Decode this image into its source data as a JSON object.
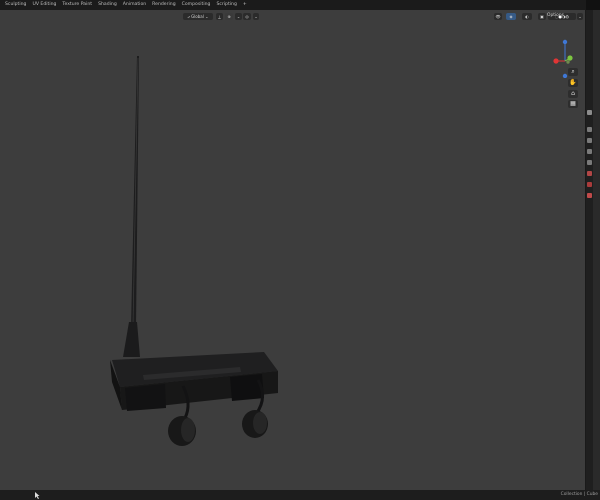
{
  "topbar": {
    "tabs": [
      "Sculpting",
      "UV Editing",
      "Texture Paint",
      "Shading",
      "Animation",
      "Rendering",
      "Compositing",
      "Scripting",
      "+"
    ]
  },
  "viewport": {
    "orientation": "Global",
    "options_label": "Options ⌄"
  },
  "status": {
    "text": "Collection | Cube"
  },
  "icons": {
    "gizmo": "axis-gizmo-icon",
    "zoom": "zoom-icon",
    "pan": "hand-icon",
    "camera": "camera-icon",
    "ortho": "grid-icon"
  },
  "colors": {
    "x_axis": "#e13535",
    "y_axis": "#7dc641",
    "z_axis": "#3f78d6",
    "accent": "#4b78b3"
  }
}
